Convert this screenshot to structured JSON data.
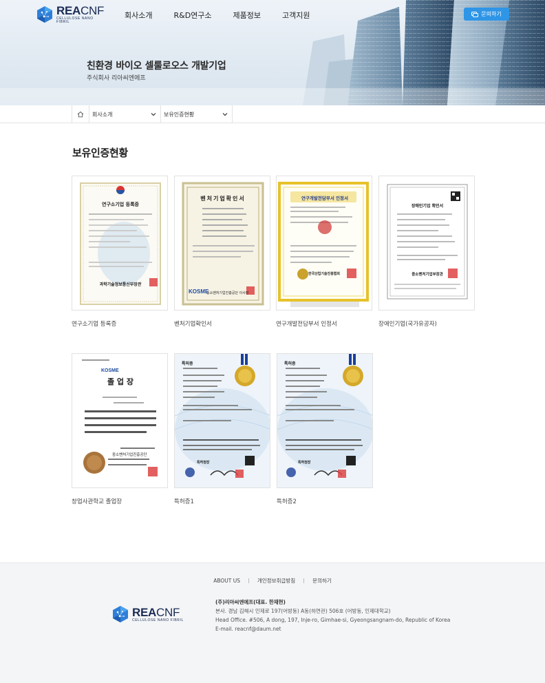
{
  "brand": {
    "name_bold": "REA",
    "name_thin": "CNF",
    "tagline": "CELLULOSE NANO FIBRIL"
  },
  "nav": {
    "items": [
      "회사소개",
      "R&D연구소",
      "제품정보",
      "고객지원"
    ]
  },
  "inquiry_button": "문의하기",
  "hero": {
    "title": "친환경 바이오 셀룰로오스 개발기업",
    "subtitle": "주식회사 리아씨엔에프"
  },
  "breadcrumb": {
    "level1": "회사소개",
    "level2": "보유인증현황"
  },
  "page_title": "보유인증현황",
  "certificates": [
    {
      "caption": "연구소기업 등록증",
      "doc_title": "연구소기업 등록증",
      "issuer": "과학기술정보통신부장관"
    },
    {
      "caption": "벤처기업확인서",
      "doc_title": "벤처기업확인서",
      "issuer": "중소벤처기업진흥공단 이사장"
    },
    {
      "caption": "연구개발전담부서 인정서",
      "doc_title": "연구개발전담부서 인정서",
      "issuer": "한국산업기술진흥협회"
    },
    {
      "caption": "장애인기업(국가유공자)",
      "doc_title": "장애인기업 확인서",
      "issuer": "중소벤처기업부장관"
    },
    {
      "caption": "창업사관학교 졸업장",
      "doc_title": "졸 업 장",
      "issuer": "중소벤처기업진흥공단"
    },
    {
      "caption": "특허증1",
      "doc_title": "특허증",
      "issuer": "특허청장"
    },
    {
      "caption": "특허증2",
      "doc_title": "특허증",
      "issuer": "특허청장"
    }
  ],
  "footer": {
    "links": [
      "ABOUT US",
      "개인정보취급방침",
      "문의하기"
    ],
    "company": "(주)리아씨엔에프(대표. 한재현)",
    "address_kr": "본사. 경남 김해시 인제로 197(어방동) A동(하연관) 506호 (어방동, 인제대학교)",
    "address_en": "Head Office. #506, A dong, 197, Inje-ro, Gimhae-si, Gyeongsangnam-do, Republic of Korea",
    "email": "E-mail. reacnf@daum.net"
  },
  "colors": {
    "accent": "#2f95e6",
    "brand_navy": "#1a2b55",
    "footer_bg": "#f4f5f7"
  }
}
